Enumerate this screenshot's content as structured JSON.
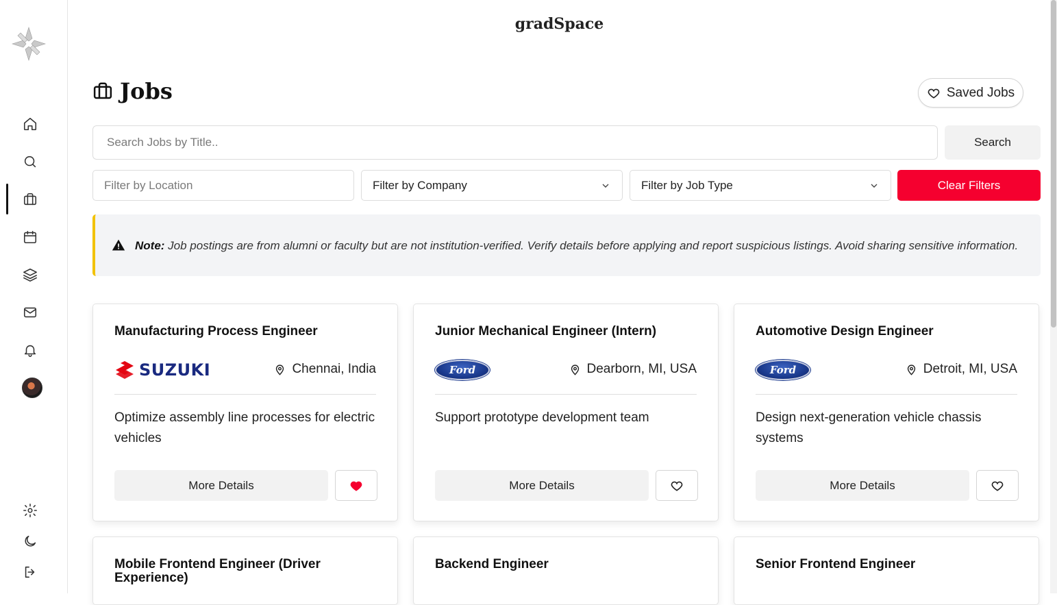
{
  "app": {
    "brand": "gradSpace"
  },
  "sidebar": {
    "items": [
      {
        "name": "home",
        "icon": "home-icon"
      },
      {
        "name": "search",
        "icon": "search-icon"
      },
      {
        "name": "jobs",
        "icon": "briefcase-icon",
        "active": true
      },
      {
        "name": "calendar",
        "icon": "calendar-icon"
      },
      {
        "name": "layers",
        "icon": "layers-icon"
      },
      {
        "name": "mail",
        "icon": "mail-icon"
      },
      {
        "name": "notifications",
        "icon": "bell-icon"
      }
    ],
    "bottom": [
      {
        "name": "settings",
        "icon": "gear-icon"
      },
      {
        "name": "theme",
        "icon": "moon-icon"
      },
      {
        "name": "logout",
        "icon": "logout-icon"
      }
    ]
  },
  "page": {
    "title": "Jobs",
    "saved_jobs_label": "Saved Jobs"
  },
  "search": {
    "placeholder": "Search Jobs by Title..",
    "button_label": "Search"
  },
  "filters": {
    "location_placeholder": "Filter by Location",
    "company_selected": "Filter by Company",
    "job_type_selected": "Filter by Job Type",
    "clear_label": "Clear Filters"
  },
  "note": {
    "label": "Note:",
    "text": " Job postings are from alumni or faculty but are not institution-verified. Verify details before applying and report suspicious listings. Avoid sharing sensitive information."
  },
  "colors": {
    "accent_red": "#f5002f",
    "note_border": "#f2c200",
    "suzuki_blue": "#1a2a80",
    "ford_blue": "#1b3a8e"
  },
  "jobs": [
    {
      "title": "Manufacturing Process Engineer",
      "company": "SUZUKI",
      "location": "Chennai, India",
      "description": "Optimize assembly line processes for electric vehicles",
      "details_label": "More Details",
      "saved": true
    },
    {
      "title": "Junior Mechanical Engineer (Intern)",
      "company": "Ford",
      "location": "Dearborn, MI, USA",
      "description": "Support prototype development team",
      "details_label": "More Details",
      "saved": false
    },
    {
      "title": "Automotive Design Engineer",
      "company": "Ford",
      "location": "Detroit, MI, USA",
      "description": "Design next-generation vehicle chassis systems",
      "details_label": "More Details",
      "saved": false
    },
    {
      "title": "Mobile Frontend Engineer (Driver Experience)"
    },
    {
      "title": "Backend Engineer"
    },
    {
      "title": "Senior Frontend Engineer"
    }
  ]
}
